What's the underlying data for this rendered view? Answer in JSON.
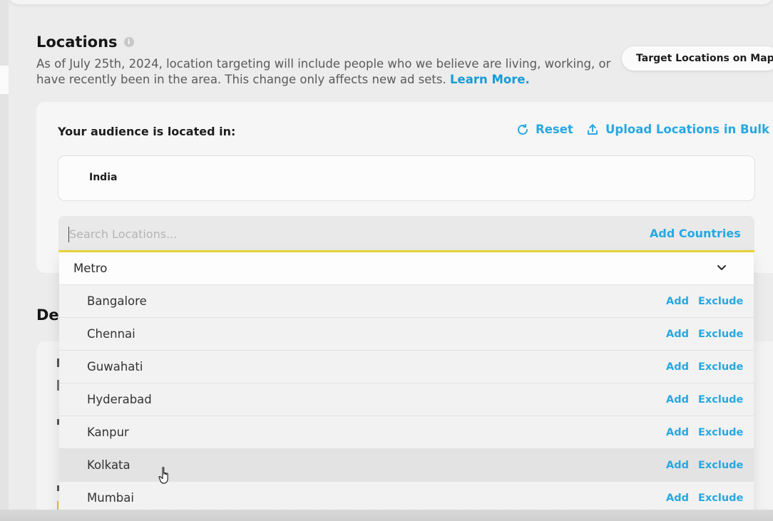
{
  "locations": {
    "title": "Locations",
    "info_icon": "info-icon",
    "description": "As of July 25th, 2024, location targeting will include people who we believe are living, working, or have recently been in the area. This change only affects new ad sets.",
    "learn_more": "Learn More.",
    "map_button_label": "Target Locations on Map"
  },
  "audience": {
    "label": "Your audience is located in:",
    "reset_label": "Reset",
    "reset_icon": "refresh-icon",
    "upload_label": "Upload Locations in Bulk",
    "upload_icon": "upload-icon",
    "selected_locations": [
      "India"
    ]
  },
  "search": {
    "placeholder": "Search Locations...",
    "value": "",
    "add_countries_label": "Add Countries"
  },
  "dropdown": {
    "group_label": "Metro",
    "group_icon": "chevron-down-icon",
    "add_label": "Add",
    "exclude_label": "Exclude",
    "items": [
      {
        "name": "Bangalore"
      },
      {
        "name": "Chennai"
      },
      {
        "name": "Guwahati"
      },
      {
        "name": "Hyderabad"
      },
      {
        "name": "Kanpur"
      },
      {
        "name": "Kolkata"
      },
      {
        "name": "Mumbai"
      }
    ],
    "hovered_item": "Kolkata"
  },
  "next_section": {
    "title_fragment": "De"
  },
  "colors": {
    "accent": "#27a8e1",
    "search_underline": "#e9d63a",
    "page_background": "#ececec"
  },
  "cursor_icon": "hand-pointer-icon"
}
